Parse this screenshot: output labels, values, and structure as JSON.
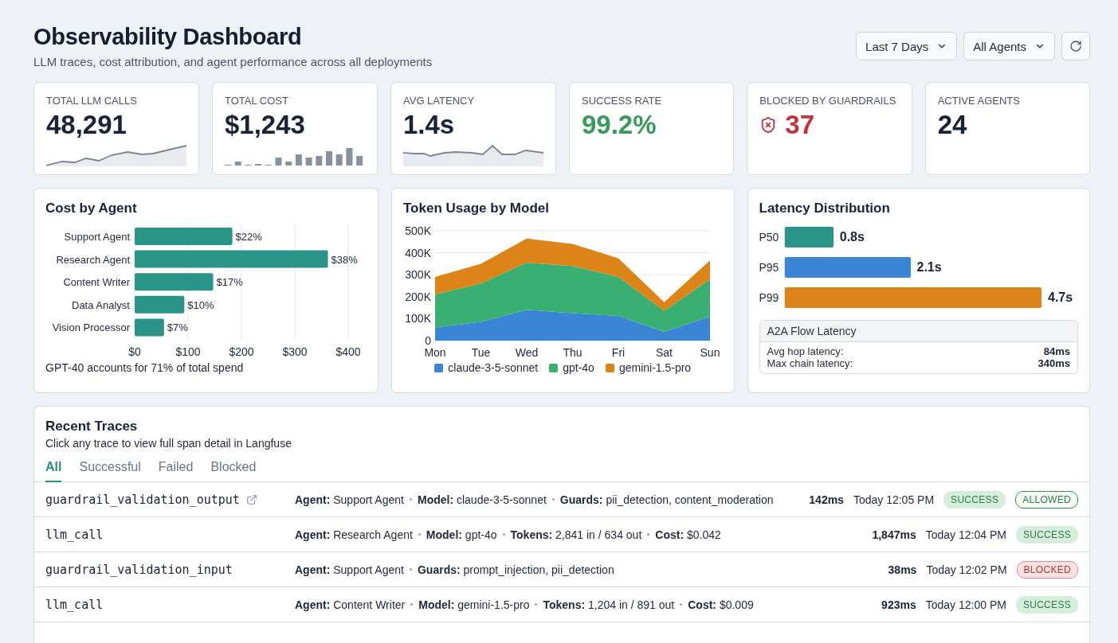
{
  "header": {
    "title": "Observability Dashboard",
    "subtitle": "LLM traces, cost attribution, and agent performance across all deployments",
    "filters": [
      {
        "label": "Last 7 Days"
      },
      {
        "label": "All Agents"
      }
    ]
  },
  "kpis": [
    {
      "label": "TOTAL LLM CALLS",
      "value": "48,291",
      "kind": "area",
      "color": "#1b2236"
    },
    {
      "label": "TOTAL COST",
      "value": "$1,243",
      "kind": "bars",
      "color": "#1b2236"
    },
    {
      "label": "AVG LATENCY",
      "value": "1.4s",
      "kind": "line",
      "color": "#1b2236"
    },
    {
      "label": "SUCCESS RATE",
      "value": "99.2%",
      "kind": "plain",
      "color": "#3a9a5c"
    },
    {
      "label": "BLOCKED BY GUARDRAILS",
      "value": "37",
      "kind": "guardrail",
      "color": "#c0343b"
    },
    {
      "label": "ACTIVE AGENTS",
      "value": "24",
      "kind": "plain",
      "color": "#1b2236"
    }
  ],
  "cost_by_agent": {
    "title": "Cost by Agent",
    "chart_data": {
      "type": "bar",
      "orientation": "horizontal",
      "categories": [
        "Support Agent",
        "Research Agent",
        "Content Writer",
        "Data Analyst",
        "Vision Processor"
      ],
      "series": [
        {
          "color": "#2a9488",
          "values": [
            183,
            362,
            147,
            93,
            55
          ]
        }
      ],
      "grid": true,
      "xlim": [
        0,
        400
      ],
      "xticks": [
        {
          "value": 0,
          "label": "$0"
        },
        {
          "value": 100,
          "label": "$100"
        },
        {
          "value": 200,
          "label": "$200"
        },
        {
          "value": 300,
          "label": "$300"
        },
        {
          "value": 400,
          "label": "$400"
        }
      ],
      "value_labels": [
        "$22%",
        "$38%",
        "$17%",
        "$10%",
        "$7%"
      ]
    },
    "note": "GPT-40 accounts for 71% of total spend"
  },
  "token_usage": {
    "title": "Token Usage by Model",
    "chart_data": {
      "type": "area",
      "stacked": true,
      "categories": [
        "Mon",
        "Tue",
        "Wed",
        "Thu",
        "Fri",
        "Sat",
        "Sun"
      ],
      "series": [
        {
          "name": "claude-3-5-sonnet",
          "color": "#3b86d4",
          "values": [
            60,
            85,
            140,
            125,
            112,
            40,
            110
          ]
        },
        {
          "name": "gpt-4o",
          "color": "#3aaf72",
          "values": [
            150,
            175,
            215,
            215,
            178,
            95,
            170
          ]
        },
        {
          "name": "gemini-1.5-pro",
          "color": "#dd8419",
          "values": [
            80,
            90,
            110,
            100,
            85,
            40,
            85
          ]
        }
      ],
      "grid": true,
      "ylim": [
        0,
        500
      ],
      "yticks": [
        {
          "value": 0,
          "label": "0"
        },
        {
          "value": 100,
          "label": "100K"
        },
        {
          "value": 200,
          "label": "200K"
        },
        {
          "value": 300,
          "label": "300K"
        },
        {
          "value": 400,
          "label": "400K"
        },
        {
          "value": 500,
          "label": "500K"
        }
      ]
    }
  },
  "latency": {
    "title": "Latency Distribution",
    "bars": [
      {
        "label": "P50",
        "reading": "0.8s",
        "color": "#2a9488",
        "level": 0.19
      },
      {
        "label": "P95",
        "reading": "2.1s",
        "color": "#3b86d4",
        "level": 0.49
      },
      {
        "label": "P99",
        "reading": "4.7s",
        "color": "#dd8419",
        "level": 1.0
      }
    ],
    "a2a": {
      "title": "A2A Flow Latency",
      "rows": [
        {
          "label": "Avg hop latency:",
          "value": "84ms"
        },
        {
          "label": "Max chain latency:",
          "value": "340ms"
        }
      ]
    }
  },
  "traces": {
    "title": "Recent Traces",
    "subtitle": "Click any trace to view full span detail in Langfuse",
    "tabs": [
      {
        "label": "All",
        "selected": true
      },
      {
        "label": "Successful",
        "selected": false
      },
      {
        "label": "Failed",
        "selected": false
      },
      {
        "label": "Blocked",
        "selected": false
      }
    ],
    "rows": [
      {
        "name": "guardrail_validation_output",
        "external_link": true,
        "details": [
          {
            "label": "Agent:",
            "value": "Support Agent"
          },
          {
            "label": "Model:",
            "value": "claude-3-5-sonnet"
          },
          {
            "label": "Guards:",
            "value": "pii_detection, content_moderation"
          }
        ],
        "duration": "142ms",
        "time": "Today 12:05 PM",
        "badges": [
          {
            "text": "SUCCESS",
            "kind": "success"
          },
          {
            "text": "ALLOWED",
            "kind": "allowed"
          }
        ]
      },
      {
        "name": "llm_call",
        "external_link": false,
        "details": [
          {
            "label": "Agent:",
            "value": "Research Agent"
          },
          {
            "label": "Model:",
            "value": "gpt-4o"
          },
          {
            "label": "Tokens:",
            "value": "2,841 in / 634 out"
          },
          {
            "label": "Cost:",
            "value": "$0.042"
          }
        ],
        "duration": "1,847ms",
        "time": "Today 12:04 PM",
        "badges": [
          {
            "text": "SUCCESS",
            "kind": "success"
          }
        ]
      },
      {
        "name": "guardrail_validation_input",
        "external_link": false,
        "details": [
          {
            "label": "Agent:",
            "value": "Support Agent"
          },
          {
            "label": "Guards:",
            "value": "prompt_injection, pii_detection"
          }
        ],
        "duration": "38ms",
        "time": "Today 12:02 PM",
        "badges": [
          {
            "text": "BLOCKED",
            "kind": "blocked"
          }
        ]
      },
      {
        "name": "llm_call",
        "external_link": false,
        "details": [
          {
            "label": "Agent:",
            "value": "Content Writer"
          },
          {
            "label": "Model:",
            "value": "gemini-1.5-pro"
          },
          {
            "label": "Tokens:",
            "value": "1,204 in / 891 out"
          },
          {
            "label": "Cost:",
            "value": "$0.009"
          }
        ],
        "duration": "923ms",
        "time": "Today 12:00 PM",
        "badges": [
          {
            "text": "SUCCESS",
            "kind": "success"
          }
        ]
      }
    ]
  }
}
